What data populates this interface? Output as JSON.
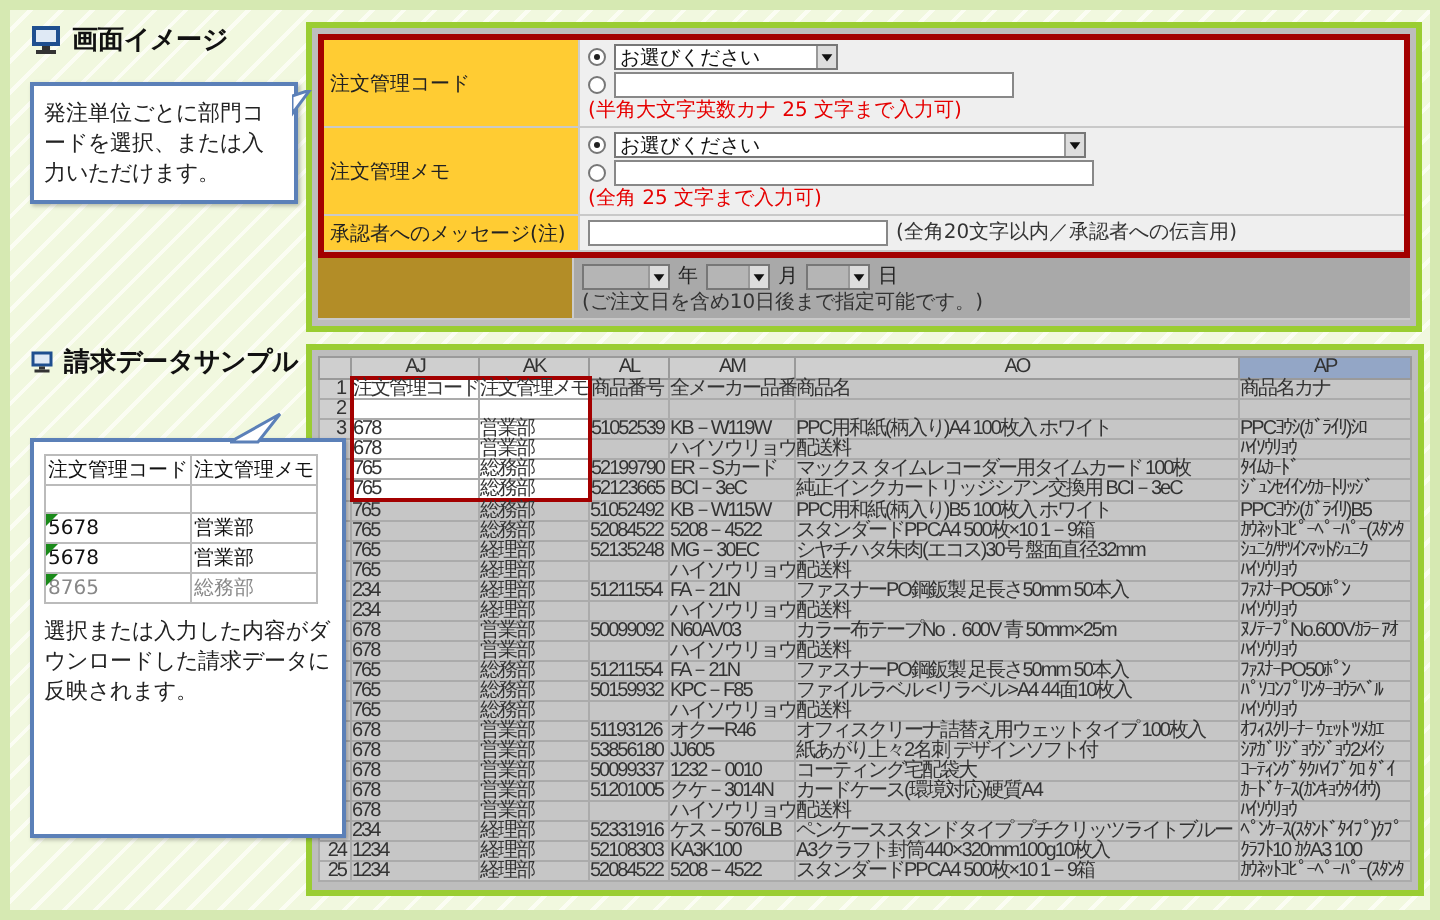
{
  "screen_image": {
    "title": "画面イメージ",
    "callout": "発注単位ごとに部門コードを選択、または入力いただけます。",
    "form": [
      {
        "kind": "choice",
        "label": "注文管理コード",
        "highlighted": true,
        "wide": false,
        "options": [
          {
            "kind": "select",
            "selected": true,
            "value": "お選びください"
          },
          {
            "kind": "input",
            "selected": false
          }
        ],
        "note": "(半角大文字英数カナ 25 文字まで入力可)"
      },
      {
        "kind": "choice",
        "label": "注文管理メモ",
        "highlighted": true,
        "wide": true,
        "options": [
          {
            "kind": "select",
            "selected": true,
            "value": "お選びください"
          },
          {
            "kind": "input",
            "selected": false
          }
        ],
        "note": "(全角 25 文字まで入力可)"
      },
      {
        "kind": "text",
        "label": "承認者へのメッセージ(注)",
        "highlighted": true,
        "note": "(全角20文字以内／承認者への伝言用)"
      },
      {
        "kind": "date",
        "highlighted": false,
        "units": [
          "年",
          "月",
          "日"
        ],
        "note": "(ご注文日を含め10日後まで指定可能です。)"
      }
    ]
  },
  "billing_sample": {
    "title": "請求データサンプル",
    "callout": {
      "columns": [
        "注文管理コード",
        "注文管理メモ"
      ],
      "rows": [
        {
          "cells": [
            null,
            null
          ]
        },
        {
          "cells": [
            "5678",
            "営業部"
          ],
          "flagged": true,
          "faded": false
        },
        {
          "cells": [
            "5678",
            "営業部"
          ],
          "flagged": true,
          "faded": false
        },
        {
          "cells": [
            "8765",
            "総務部"
          ],
          "flagged": true,
          "faded": true
        }
      ],
      "text": "選択または入力した内容がダウンロードした請求データに反映されます。"
    },
    "sheet": {
      "columns": [
        {
          "label": "AJ",
          "selected": false
        },
        {
          "label": "AK",
          "selected": false
        },
        {
          "label": "AL",
          "selected": false
        },
        {
          "label": "AM",
          "selected": false
        },
        {
          "label": "AO",
          "selected": false
        },
        {
          "label": "AP",
          "selected": true
        }
      ],
      "rows": [
        {
          "num": "1",
          "marked": true,
          "cells": [
            "注文管理コード",
            "注文管理メモ",
            "商品番号",
            "全メーカー品番",
            "商品名",
            "商品名カナ"
          ]
        },
        {
          "num": "2",
          "marked": true,
          "cells": [
            null,
            null,
            null,
            null,
            null,
            null
          ]
        },
        {
          "num": "3",
          "marked": true,
          "cells": [
            "678",
            "営業部",
            "51052539",
            "KB－W119W",
            "PPC用和紙(柄入り)A4 100枚入 ホワイト",
            "PPCﾖｳｼ(ｶﾞﾗｲﾘ)ｼﾛ"
          ]
        },
        {
          "marked": true,
          "cells": [
            "678",
            "営業部",
            null,
            "ハイソウリョウ",
            "配送料",
            "ﾊｲｿｳﾘｮｳ"
          ]
        },
        {
          "marked": true,
          "cells": [
            "765",
            "総務部",
            "52199790",
            "ER－Sカード",
            "マックス タイムレコーダー用タイムカード 100枚",
            "ﾀｲﾑｶｰﾄﾞ"
          ]
        },
        {
          "marked": true,
          "cells": [
            "765",
            "総務部",
            "52123665",
            "BCI－3eC",
            "純正インクカートリッジシアン交換用 BCI－3eC",
            "ｼﾞｭﾝｾｲｲﾝｸｶｰﾄﾘｯｼﾞ"
          ]
        },
        {
          "marked": false,
          "cells": [
            "765",
            "総務部",
            "51052492",
            "KB－W115W",
            "PPC用和紙(柄入り)B5 100枚入 ホワイト",
            "PPCﾖｳｼ(ｶﾞﾗｲﾘ)B5"
          ]
        },
        {
          "marked": false,
          "cells": [
            "765",
            "総務部",
            "52084522",
            "5208－4522",
            "スタンダードPPCA4 500枚×10 1－9箱",
            "ｶｳﾈｯﾄｺﾋﾟｰﾍﾟｰﾊﾟｰ(ｽﾀﾝﾀ"
          ]
        },
        {
          "marked": false,
          "cells": [
            "765",
            "経理部",
            "52135248",
            "MG－30EC",
            "シヤチハタ朱肉(エコス)30号 盤面直径32mm",
            "ｼｭﾆｸ/ｻﾂｲﾝﾏｯﾄ/ｼｭﾆｸ"
          ]
        },
        {
          "marked": false,
          "cells": [
            "765",
            "経理部",
            null,
            "ハイソウリョウ",
            "配送料",
            "ﾊｲｿｳﾘｮｳ"
          ]
        },
        {
          "marked": false,
          "cells": [
            "234",
            "経理部",
            "51211554",
            "FA－21N",
            "ファスナーPO鋼鈑製 足長さ50mm 50本入",
            "ﾌｧｽﾅｰPO50ﾎﾟﾝ"
          ]
        },
        {
          "marked": false,
          "cells": [
            "234",
            "経理部",
            null,
            "ハイソウリョウ",
            "配送料",
            "ﾊｲｿｳﾘｮｳ"
          ]
        },
        {
          "marked": false,
          "cells": [
            "678",
            "営業部",
            "50099092",
            "N60AV03",
            "カラー布テープNo．600V 青 50mm×25m",
            "ﾇﾉﾃｰﾌﾟNo.600Vｶﾗｰ ｱｵ"
          ]
        },
        {
          "marked": false,
          "cells": [
            "678",
            "営業部",
            null,
            "ハイソウリョウ",
            "配送料",
            "ﾊｲｿｳﾘｮｳ"
          ]
        },
        {
          "marked": false,
          "cells": [
            "765",
            "総務部",
            "51211554",
            "FA－21N",
            "ファスナーPO鋼鈑製 足長さ50mm 50本入",
            "ﾌｧｽﾅｰPO50ﾎﾟﾝ"
          ]
        },
        {
          "marked": false,
          "cells": [
            "765",
            "総務部",
            "50159932",
            "KPC－F85",
            "ファイルラベル <リラベル>A4 44面10枚入",
            "ﾊﾟｿｺﾝﾌﾟﾘﾝﾀｰﾖｳﾗﾍﾞﾙ"
          ]
        },
        {
          "marked": false,
          "cells": [
            "765",
            "総務部",
            null,
            "ハイソウリョウ",
            "配送料",
            "ﾊｲｿｳﾘｮｳ"
          ]
        },
        {
          "marked": false,
          "cells": [
            "678",
            "営業部",
            "51193126",
            "オクーR46",
            "オフィスクリーナ詰替え用ウェットタイプ 100枚入",
            "ｵﾌｨｽｸﾘｰﾅｰ ｳｪｯﾄ ﾂﾒｶｴ"
          ]
        },
        {
          "marked": false,
          "cells": [
            "678",
            "営業部",
            "53856180",
            "JJ605",
            "紙あがり上々2名刺 デザインソフト付",
            "ｼｱｶﾞﾘｼﾞｮｳｼﾞｮｳ2ﾒｲｼ"
          ]
        },
        {
          "marked": false,
          "cells": [
            "678",
            "営業部",
            "50099337",
            "1232－0010",
            "コーティング宅配袋大",
            "ｺｰﾃｨﾝｸﾞﾀｸﾊｲﾌﾞｸﾛ ﾀﾞｲ"
          ]
        },
        {
          "marked": false,
          "cells": [
            "678",
            "営業部",
            "51201005",
            "クケ－3014N",
            "カードケース(環境対応)硬質A4",
            "ｶｰﾄﾞｹｰｽ(ｶﾝｷｮｳﾀｲｵｳ)"
          ]
        },
        {
          "marked": false,
          "cells": [
            "678",
            "営業部",
            null,
            "ハイソウリョウ",
            "配送料",
            "ﾊｲｿｳﾘｮｳ"
          ]
        },
        {
          "marked": false,
          "cells": [
            "234",
            "経理部",
            "52331916",
            "ケス－5076LB",
            "ペンケーススタンドタイプ プチクリッツライトブルー",
            "ﾍﾟﾝｹｰｽ(ｽﾀﾝﾄﾞﾀｲﾌﾟ)ｸﾌﾟ"
          ]
        },
        {
          "num": "24",
          "marked": false,
          "cells": [
            "1234",
            "経理部",
            "52108303",
            "KA3K100",
            "A3クラフト封筒440×320mm100g10枚入",
            "ｸﾗﾌﾄ10 ｶｸA3 100"
          ]
        },
        {
          "num": "25",
          "marked": false,
          "cells": [
            "1234",
            "経理部",
            "52084522",
            "5208－4522",
            "スタンダードPPCA4 500枚×10 1－9箱",
            "ｶｳﾈｯﾄｺﾋﾟｰﾍﾟｰﾊﾟｰ(ｽﾀﾝﾀ"
          ]
        }
      ]
    }
  }
}
